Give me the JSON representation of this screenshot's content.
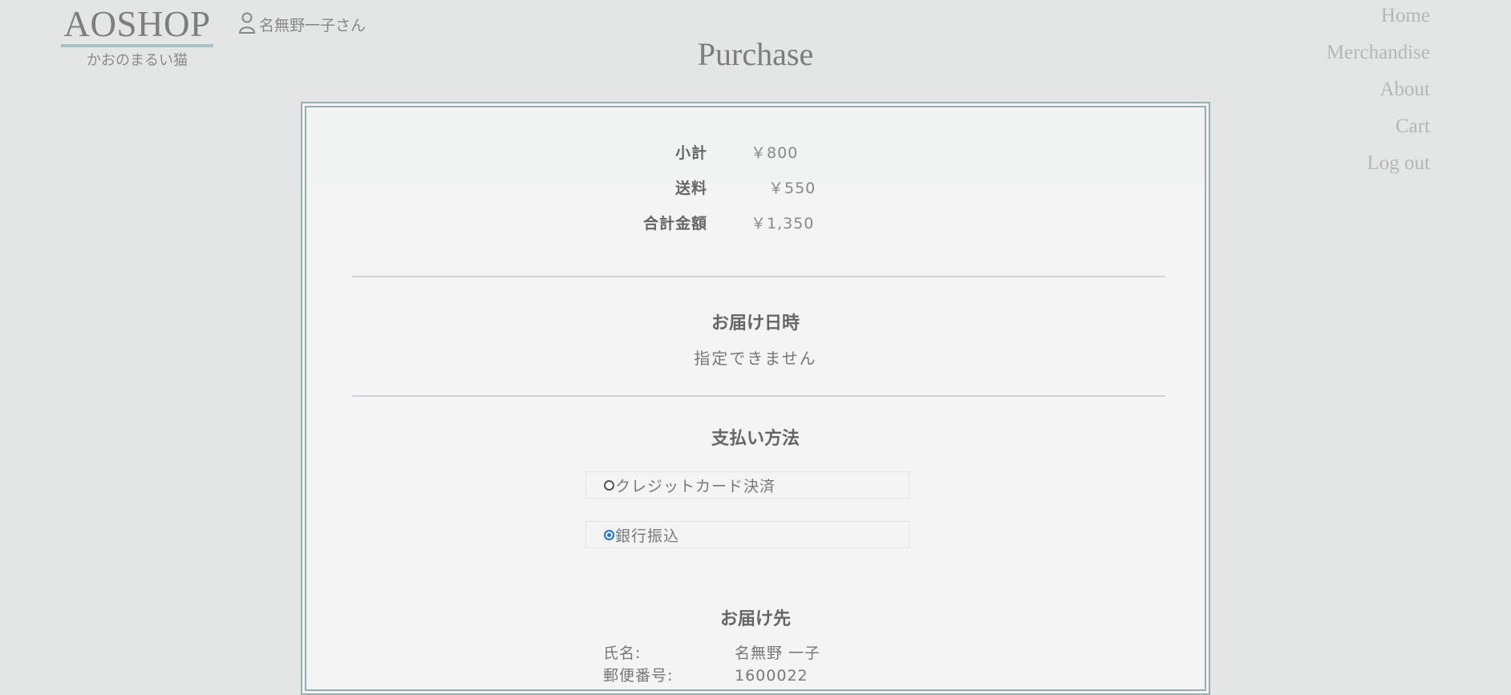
{
  "header": {
    "logo_main": "AOSHOP",
    "logo_sub": "かおのまるい猫",
    "user_name": "名無野一子さん",
    "page_title": "Purchase"
  },
  "nav": {
    "items": [
      "Home",
      "Merchandise",
      "About",
      "Cart",
      "Log out"
    ]
  },
  "summary": {
    "rows": [
      {
        "label": "小計",
        "value": "￥800"
      },
      {
        "label": "送料",
        "value": "￥550"
      },
      {
        "label": "合計金額",
        "value": "￥1,350"
      }
    ]
  },
  "delivery_date": {
    "title": "お届け日時",
    "text": "指定できません"
  },
  "payment": {
    "title": "支払い方法",
    "options": [
      {
        "label": "クレジットカード決済",
        "checked": false
      },
      {
        "label": "銀行振込",
        "checked": true
      }
    ]
  },
  "destination": {
    "title": "お届け先",
    "rows": [
      {
        "key": "氏名:",
        "value": "名無野 一子"
      },
      {
        "key": "郵便番号:",
        "value": "1600022"
      }
    ]
  },
  "colors": {
    "accent": "#a9c0c6",
    "border": "#96adb1",
    "radio_checked": "#1a73e8"
  }
}
